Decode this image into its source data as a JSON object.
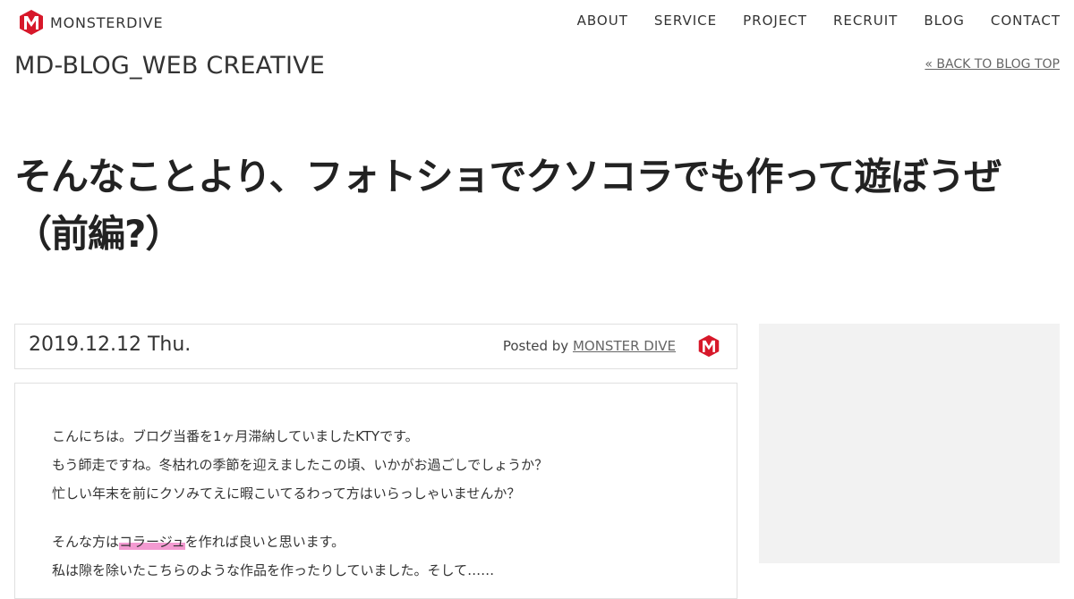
{
  "header": {
    "logo_text": "MONSTERDIVE",
    "nav": [
      "ABOUT",
      "SERVICE",
      "PROJECT",
      "RECRUIT",
      "BLOG",
      "CONTACT"
    ]
  },
  "blog": {
    "title": "MD-BLOG_WEB CREATIVE",
    "back_link": "« BACK TO BLOG TOP"
  },
  "article": {
    "title": "そんなことより、フォトショでクソコラでも作って遊ぼうぜ（前編?）",
    "date": "2019.12.12 Thu.",
    "posted_by_label": "Posted by",
    "author": "MONSTER DIVE",
    "paragraphs": [
      "こんにちは。ブログ当番を1ヶ月滞納していましたKTYです。",
      "もう師走ですね。冬枯れの季節を迎えましたこの頃、いかがお過ごしでしょうか？",
      "忙しい年末を前にクソみてえに暇こいてるわって方はいらっしゃいませんか？"
    ],
    "p4_before": "そんな方は",
    "p4_highlight": "コラージュ",
    "p4_after": "を作れば良いと思います。",
    "p5": "私は隙を除いたこちらのような作品を作ったりしていました。そして……"
  },
  "colors": {
    "brand_red": "#d7182a",
    "highlight_pink": "#f39ad1",
    "sidebar_bg": "#f2f2f2"
  },
  "icons": {
    "logo": "monsterdive-m-logo-icon",
    "author": "monsterdive-m-avatar-icon"
  }
}
